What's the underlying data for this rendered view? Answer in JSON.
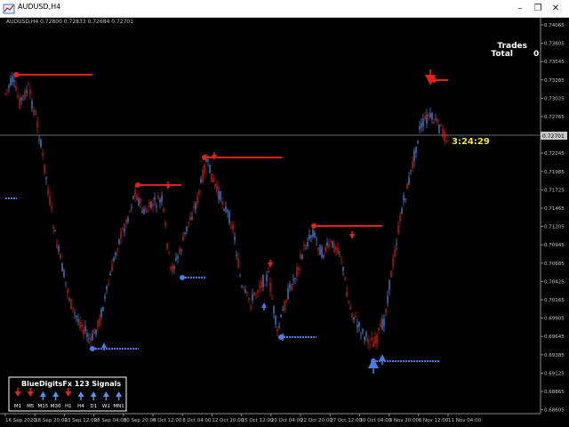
{
  "window": {
    "title": "AUDUSD,H4",
    "minimize_glyph": "–",
    "restore_glyph": "❐",
    "close_glyph": "✕"
  },
  "quote_header": "AUDUSD,H4  0.72800 0.72833 0.72684 0.72701",
  "price_axis": {
    "labels": [
      "0.74065",
      "0.73805",
      "0.73545",
      "0.73285",
      "0.73025",
      "0.72765",
      "0.72505",
      "0.72245",
      "0.71985",
      "0.71725",
      "0.71465",
      "0.71205",
      "0.70945",
      "0.70685",
      "0.70425",
      "0.70165",
      "0.69905",
      "0.69645",
      "0.69385",
      "0.69125",
      "0.68865",
      "0.68605"
    ],
    "current_price": "0.72701"
  },
  "time_axis": {
    "labels": [
      "16 Sep 2020",
      "18 Sep 20:00",
      "23 Sep 12:00",
      "28 Sep 04:00",
      "30 Sep 20:00",
      "5 Oct 12:00",
      "8 Oct 04:00",
      "12 Oct 20:00",
      "15 Oct 12:00",
      "20 Oct 04:00",
      "22 Oct 20:00",
      "27 Oct 12:00",
      "30 Oct 04:00",
      "3 Nov 20:00",
      "6 Nov 12:00",
      "11 Nov 04:00"
    ]
  },
  "trades_panel": {
    "label1": "Trades",
    "label2": "Total",
    "value": "0"
  },
  "countdown": "3:24:29",
  "signals_panel": {
    "title": "BlueDigitsFx 123 Signals",
    "timeframes": [
      {
        "tf": "M1",
        "dir": "down"
      },
      {
        "tf": "M5",
        "dir": "down"
      },
      {
        "tf": "M15",
        "dir": "up"
      },
      {
        "tf": "M30",
        "dir": "up"
      },
      {
        "tf": "H1",
        "dir": "down"
      },
      {
        "tf": "H4",
        "dir": "up"
      },
      {
        "tf": "D1",
        "dir": "up"
      },
      {
        "tf": "W1",
        "dir": "up"
      },
      {
        "tf": "MN1",
        "dir": "up"
      }
    ]
  },
  "colors": {
    "bull": "#5b8fe8",
    "bear": "#e0231b",
    "sell_line": "#e0201c",
    "buy_line": "#4a7be0",
    "axis_text": "#c8c8c8",
    "countdown": "#f0e040",
    "panel_text": "#ffffff"
  }
}
